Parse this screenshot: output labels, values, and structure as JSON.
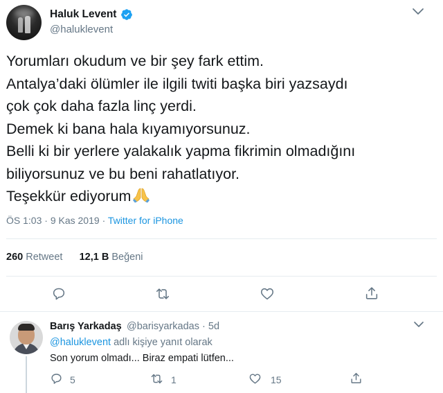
{
  "tweet": {
    "author_name": "Haluk Levent",
    "author_handle": "@haluklevent",
    "lines": [
      "Yorumları okudum ve bir şey fark ettim.",
      "Antalya’daki ölümler ile ilgili twiti başka biri yazsaydı",
      "çok çok daha fazla linç yerdi.",
      "Demek ki bana hala kıyamıyorsunuz.",
      "Belli ki bir yerlere yalakalık yapma fikrimin olmadığını",
      "biliyorsunuz ve bu beni rahatlatıyor.",
      "Teşekkür ediyorum"
    ],
    "emoji": "folded-hands",
    "time": "ÖS 1:03",
    "date": "9 Kas 2019",
    "separator": "·",
    "source": "Twitter for iPhone",
    "retweet_count": "260",
    "retweet_label": "Retweet",
    "like_count": "12,1 B",
    "like_label": "Beğeni"
  },
  "reply": {
    "author_name": "Barış Yarkadaş",
    "author_handle": "@barisyarkadas",
    "separator": "·",
    "age": "5d",
    "replying_handle": "@haluklevent",
    "replying_suffix": "adlı kişiye yanıt olarak",
    "text": "Son yorum olmadı... Biraz empati lütfen...",
    "reply_count": "5",
    "retweet_count": "1",
    "like_count": "15"
  },
  "icons": {
    "verified": "verified-badge-icon",
    "caret": "chevron-down-icon",
    "reply": "reply-bubble-icon",
    "retweet": "retweet-icon",
    "like": "heart-icon",
    "share": "share-icon"
  },
  "colors": {
    "text": "#14171a",
    "secondary": "#657786",
    "link": "#1b95e0",
    "divider": "#e6ecf0"
  }
}
